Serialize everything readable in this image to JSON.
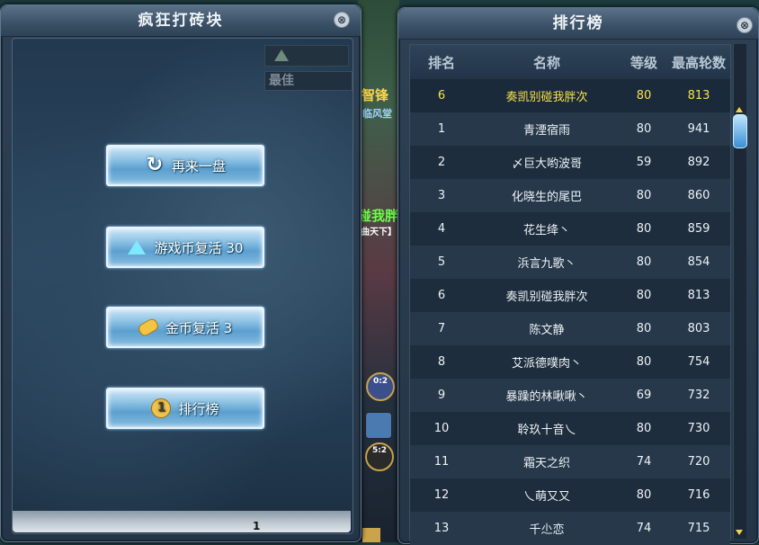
{
  "scene": {
    "hero_name": "智锋",
    "hero_guild": "临风堂",
    "other_name": "碰我胖",
    "other_tag": "曲天下】",
    "skill1_label": "0:2",
    "skill3_label": "5:2"
  },
  "game_panel": {
    "title": "疯狂打砖块",
    "close_label": "⊗",
    "best_label": "最佳",
    "page_number": "1",
    "buttons": {
      "restart": "再来一盘",
      "revive_coin": "游戏币复活 30",
      "revive_gold": "金币复活 3",
      "rank": "排行榜"
    },
    "rank_icon_text": "1"
  },
  "rank_panel": {
    "title": "排行榜",
    "close_label": "⊗",
    "headers": {
      "rank": "排名",
      "name": "名称",
      "level": "等级",
      "best": "最高轮数"
    },
    "self_row": {
      "rank": "6",
      "name": "奏凯别碰我胖次",
      "level": "80",
      "best": "813"
    },
    "rows": [
      {
        "rank": "1",
        "name": "青湮宿雨",
        "level": "80",
        "best": "941"
      },
      {
        "rank": "2",
        "name": "〆巨大哟波哥",
        "level": "59",
        "best": "892"
      },
      {
        "rank": "3",
        "name": "化晓生的尾巴",
        "level": "80",
        "best": "860"
      },
      {
        "rank": "4",
        "name": "花生绛丶",
        "level": "80",
        "best": "859"
      },
      {
        "rank": "5",
        "name": "浜言九歌丶",
        "level": "80",
        "best": "854"
      },
      {
        "rank": "6",
        "name": "奏凯别碰我胖次",
        "level": "80",
        "best": "813"
      },
      {
        "rank": "7",
        "name": "陈文静",
        "level": "80",
        "best": "803"
      },
      {
        "rank": "8",
        "name": "艾派德噗肉丶",
        "level": "80",
        "best": "754"
      },
      {
        "rank": "9",
        "name": "暴躁的林啾啾丶",
        "level": "69",
        "best": "732"
      },
      {
        "rank": "10",
        "name": "聆玖十音乀",
        "level": "80",
        "best": "730"
      },
      {
        "rank": "11",
        "name": "霜天之织",
        "level": "74",
        "best": "720"
      },
      {
        "rank": "12",
        "name": "乀萌又又",
        "level": "80",
        "best": "716"
      },
      {
        "rank": "13",
        "name": "千尐恋",
        "level": "74",
        "best": "715"
      }
    ]
  },
  "colors": {
    "self_highlight": "#f6e24a",
    "button_blue": "#5b9fd0"
  }
}
